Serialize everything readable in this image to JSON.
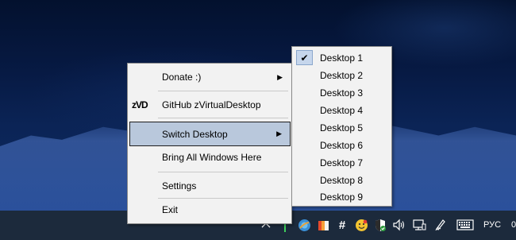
{
  "context_menu": {
    "items": [
      {
        "label": "Donate :)",
        "has_submenu": true
      },
      {
        "label": "GitHub zVirtualDesktop",
        "icon": "zvd-logo",
        "logo_text": "zVD"
      },
      {
        "label": "Switch Desktop",
        "has_submenu": true,
        "highlighted": true
      },
      {
        "label": "Bring All Windows Here"
      },
      {
        "label": "Settings"
      },
      {
        "label": "Exit"
      }
    ],
    "submenu_arrow": "▶"
  },
  "desktop_submenu": {
    "items": [
      {
        "label": "Desktop 1",
        "checked": true
      },
      {
        "label": "Desktop 2"
      },
      {
        "label": "Desktop 3"
      },
      {
        "label": "Desktop 4"
      },
      {
        "label": "Desktop 5"
      },
      {
        "label": "Desktop 6"
      },
      {
        "label": "Desktop 7"
      },
      {
        "label": "Desktop 8"
      },
      {
        "label": "Desktop 9"
      }
    ],
    "check_glyph": "✔"
  },
  "taskbar": {
    "tray_icons": [
      "chevron-up-icon",
      "network-status-icon",
      "globe-app-icon",
      "flag-app-icon",
      "hashtag-icon",
      "smiley-app-icon",
      "shield-icon",
      "volume-icon",
      "network-icon",
      "pen-icon",
      "keyboard-icon"
    ],
    "language": "РУС",
    "clock": "0"
  },
  "colors": {
    "menu_bg": "#f2f2f2",
    "highlight_bg": "#b9c8dc",
    "taskbar_bg": "#1c2a3c"
  }
}
